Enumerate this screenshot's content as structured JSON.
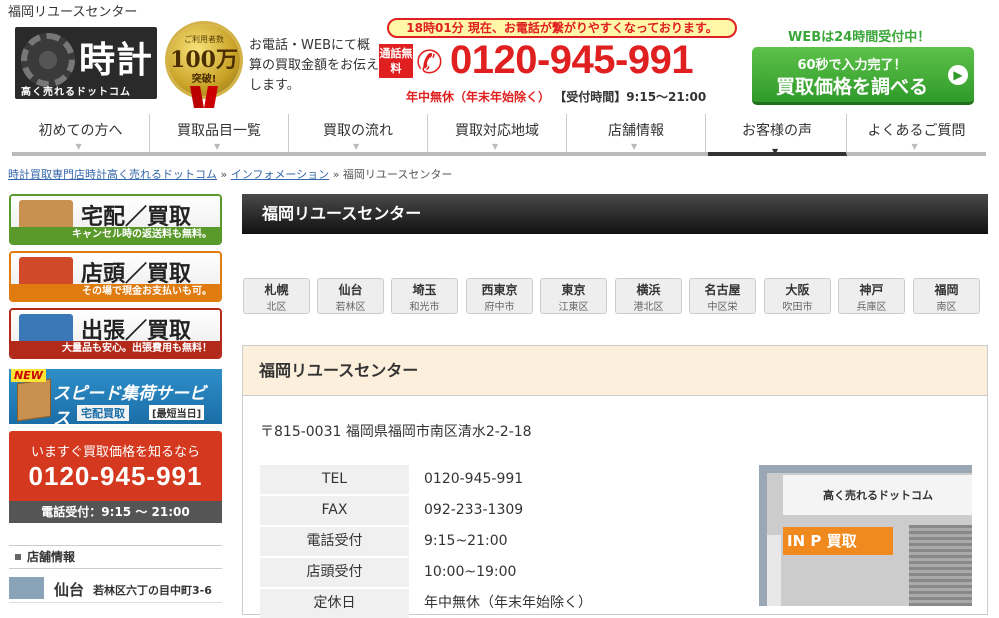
{
  "header": {
    "site_title": "福岡リユースセンター",
    "logo_main": "時計",
    "logo_sub": "高く売れるドットコム",
    "medal_line1": "ご利用者数",
    "medal_line2": "100万",
    "medal_line3": "突破!",
    "intro_text": "お電話・WEBにて概算の買取金額をお伝えします。",
    "notice": "18時01分 現在、お電話が繋がりやすくなっております。",
    "free_badge": "通話無料",
    "phone": "0120-945-991",
    "open_days": "年中無休（年末年始除く）",
    "reception_hours": "【受付時間】9:15～21:00",
    "web_24h": "WEBは24時間受付中！",
    "cta_line1": "60秒で入力完了！",
    "cta_line2": "買取価格を調べる"
  },
  "nav": {
    "items": [
      {
        "label": "初めての方へ"
      },
      {
        "label": "買取品目一覧"
      },
      {
        "label": "買取の流れ"
      },
      {
        "label": "買取対応地域"
      },
      {
        "label": "店舗情報"
      },
      {
        "label": "お客様の声"
      },
      {
        "label": "よくあるご質問"
      }
    ]
  },
  "breadcrumb": {
    "home": "時計買取専門店時計高く売れるドットコム",
    "sep": "»",
    "info": "インフォメーション",
    "current": "福岡リユースセンター"
  },
  "sidebar": {
    "buttons": [
      {
        "title": "宅配／買取",
        "sub": "キャンセル時の返送料も無料。",
        "color": "#5a9a2a"
      },
      {
        "title": "店頭／買取",
        "sub": "その場で現金お支払いも可。",
        "color": "#e07b10"
      },
      {
        "title": "出張／買取",
        "sub": "大量品も安心。出張費用も無料！",
        "color": "#b42a1a"
      }
    ],
    "speed": {
      "new": "NEW",
      "title": "スピード集荷サービス",
      "tag1": "宅配買取",
      "tag2": "[最短当日]"
    },
    "phone_box": {
      "line1": "いますぐ買取価格を知るなら",
      "number": "0120-945-991",
      "hours": "電話受付：9:15 ～ 21:00"
    },
    "store_info": "店舗情報",
    "store_city": "仙台",
    "store_addr": "若林区六丁の目中町3-6"
  },
  "main": {
    "page_title": "福岡リユースセンター",
    "cities": [
      {
        "name": "札幌",
        "ward": "北区"
      },
      {
        "name": "仙台",
        "ward": "若林区"
      },
      {
        "name": "埼玉",
        "ward": "和光市"
      },
      {
        "name": "西東京",
        "ward": "府中市"
      },
      {
        "name": "東京",
        "ward": "江東区"
      },
      {
        "name": "横浜",
        "ward": "港北区"
      },
      {
        "name": "名古屋",
        "ward": "中区栄"
      },
      {
        "name": "大阪",
        "ward": "吹田市"
      },
      {
        "name": "神戸",
        "ward": "兵庫区"
      },
      {
        "name": "福岡",
        "ward": "南区"
      }
    ],
    "box_title": "福岡リユースセンター",
    "address": "〒815-0031 福岡県福岡市南区清水2-2-18",
    "info": [
      {
        "label": "TEL",
        "value": "0120-945-991"
      },
      {
        "label": "FAX",
        "value": "092-233-1309"
      },
      {
        "label": "電話受付",
        "value": "9:15~21:00"
      },
      {
        "label": "店頭受付",
        "value": "10:00~19:00"
      },
      {
        "label": "定休日",
        "value": "年中無休（年末年始除く）"
      }
    ],
    "photo_sign": "高く売れるドットコム",
    "photo_orange": "IN P 買取"
  }
}
